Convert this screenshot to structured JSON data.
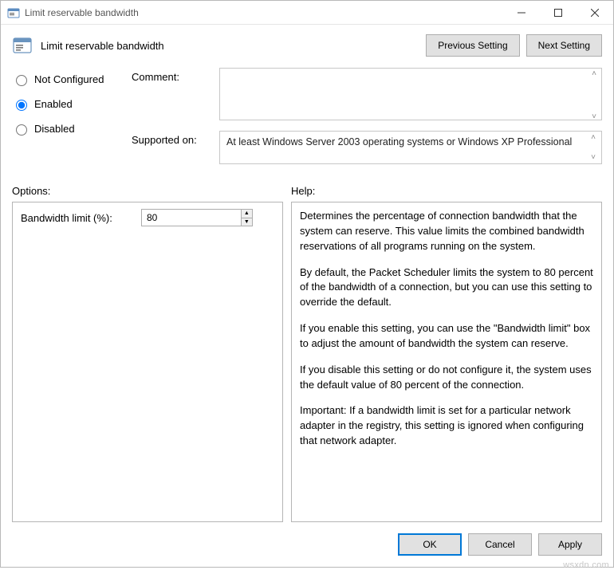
{
  "window": {
    "title": "Limit reservable bandwidth"
  },
  "header": {
    "policy_title": "Limit reservable bandwidth",
    "prev_btn": "Previous Setting",
    "next_btn": "Next Setting"
  },
  "state": {
    "not_configured": "Not Configured",
    "enabled": "Enabled",
    "disabled": "Disabled",
    "selected": "enabled"
  },
  "labels": {
    "comment": "Comment:",
    "supported_on": "Supported on:",
    "options": "Options:",
    "help": "Help:"
  },
  "comment_value": "",
  "supported_on_text": "At least Windows Server 2003 operating systems or Windows XP Professional",
  "options": {
    "bandwidth_limit_label": "Bandwidth limit (%):",
    "bandwidth_limit_value": "80"
  },
  "help": {
    "p1": "Determines the percentage of connection bandwidth that the system can reserve. This value limits the combined bandwidth reservations of all programs running on the system.",
    "p2": "By default, the Packet Scheduler limits the system to 80 percent of the bandwidth of a connection, but you can use this setting to override the default.",
    "p3": "If you enable this setting, you can use the \"Bandwidth limit\" box to adjust the amount of bandwidth the system can reserve.",
    "p4": "If you disable this setting or do not configure it, the system uses the default value of 80 percent of the connection.",
    "p5": "Important: If a bandwidth limit is set for a particular network adapter in the registry, this setting is ignored when configuring that network adapter."
  },
  "footer": {
    "ok": "OK",
    "cancel": "Cancel",
    "apply": "Apply"
  },
  "watermark": "wsxdn.com"
}
